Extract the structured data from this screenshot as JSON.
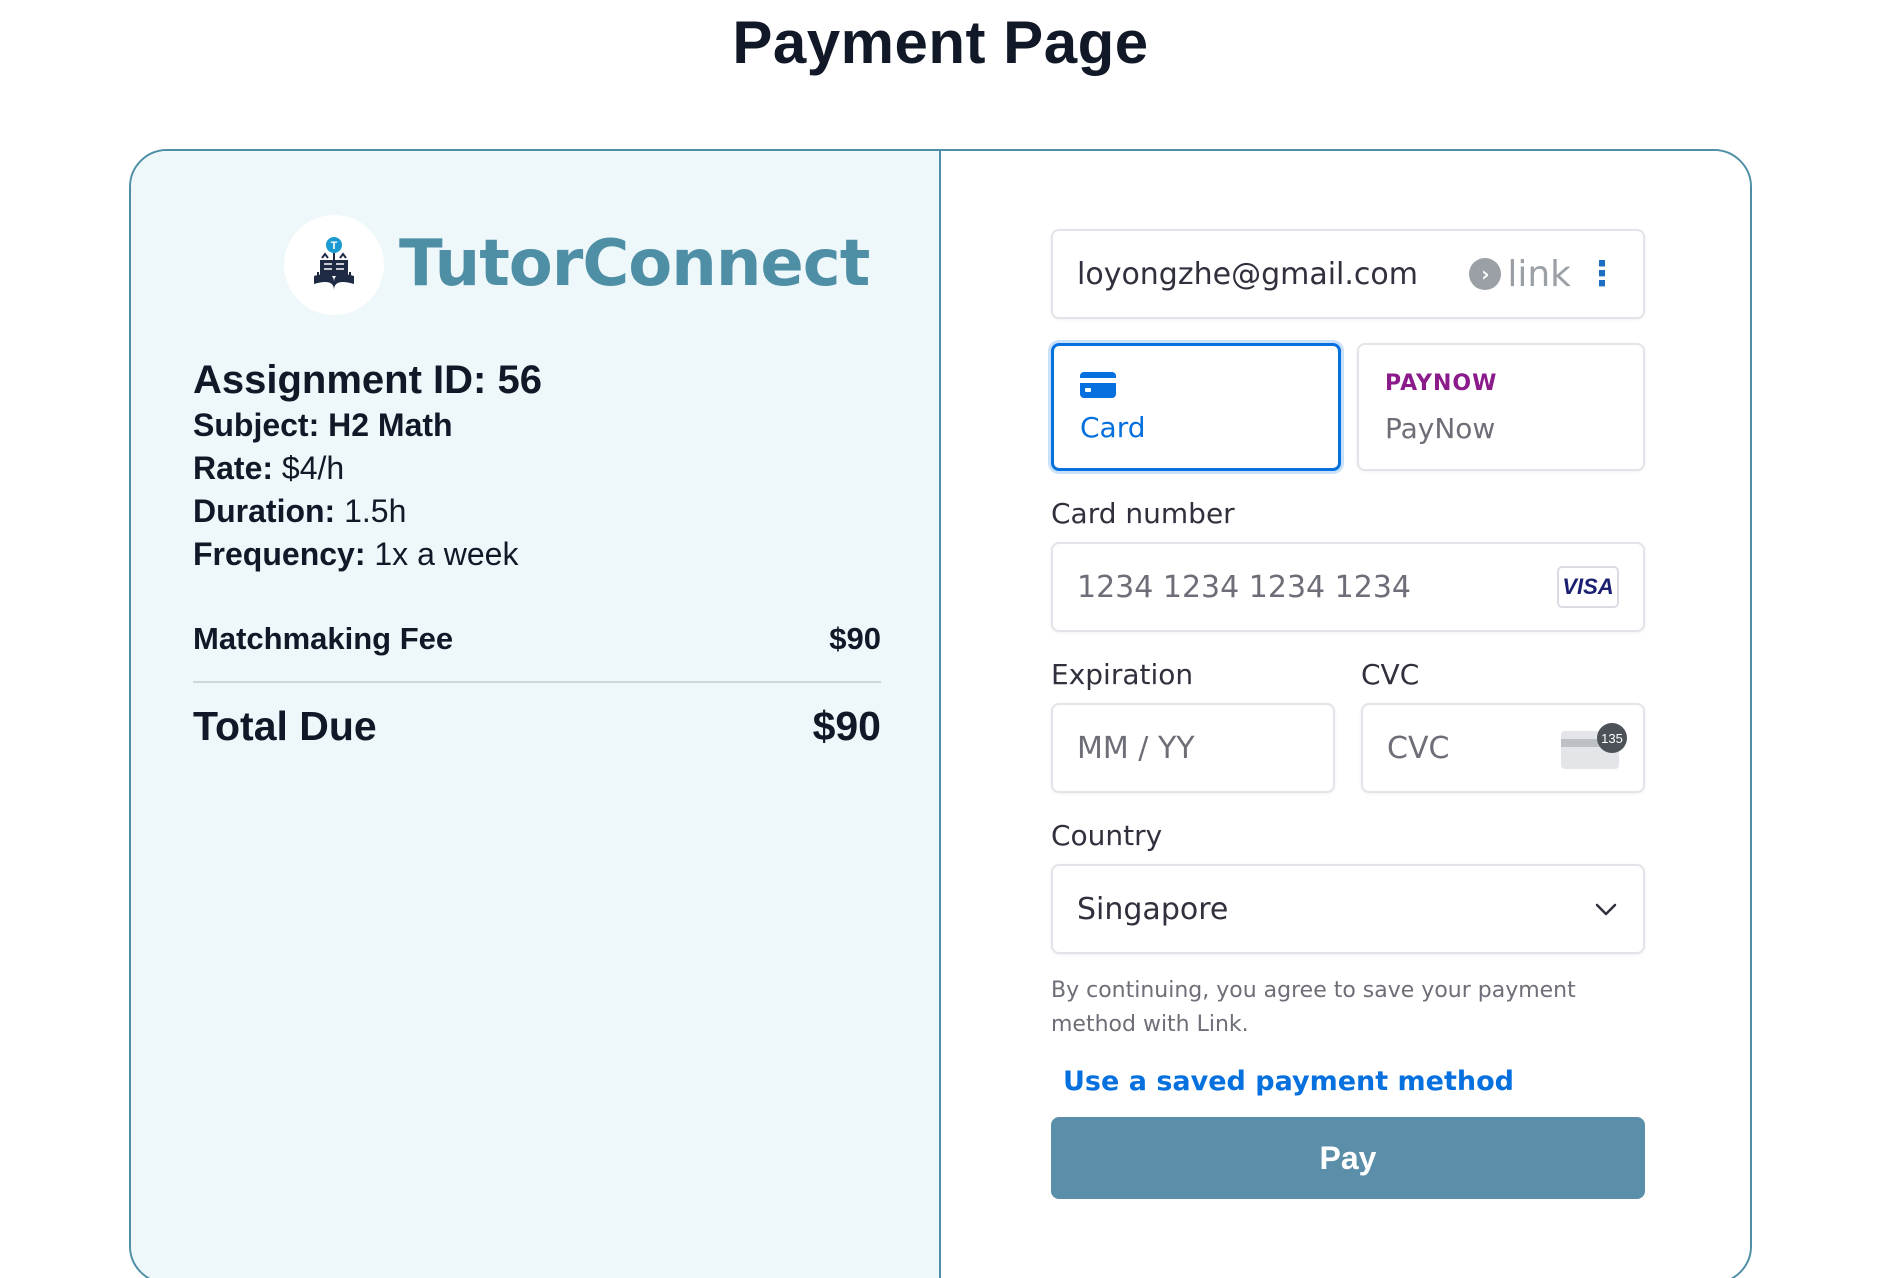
{
  "page": {
    "title": "Payment Page"
  },
  "brand": {
    "name": "TutorConnect",
    "logo_icon": "book-graduate-icon",
    "color": "#4f8fa6"
  },
  "assignment": {
    "id_label": "Assignment ID: 56",
    "subject_key": "Subject:",
    "subject_value": "H2 Math",
    "rate_key": "Rate:",
    "rate_value": "$4/h",
    "duration_key": "Duration:",
    "duration_value": "1.5h",
    "frequency_key": "Frequency:",
    "frequency_value": "1x a week"
  },
  "summary": {
    "fee_label": "Matchmaking Fee",
    "fee_value": "$90",
    "total_label": "Total Due",
    "total_value": "$90"
  },
  "payment": {
    "email": "loyongzhe@gmail.com",
    "link_label": "link",
    "tabs": [
      {
        "label": "Card",
        "icon": "credit-card-icon",
        "selected": true
      },
      {
        "label": "PayNow",
        "logo": "PAYNOW",
        "selected": false
      }
    ],
    "card_number_label": "Card number",
    "card_number_placeholder": "1234 1234 1234 1234",
    "card_brand": "VISA",
    "expiration_label": "Expiration",
    "expiration_placeholder": "MM / YY",
    "cvc_label": "CVC",
    "cvc_placeholder": "CVC",
    "cvc_badge": "135",
    "country_label": "Country",
    "country_value": "Singapore",
    "notice": "By continuing, you agree to save your payment method with Link.",
    "saved_method_link": "Use a saved payment method",
    "pay_label": "Pay",
    "accent_color": "#0570de",
    "pay_button_color": "#5b8fa9"
  }
}
